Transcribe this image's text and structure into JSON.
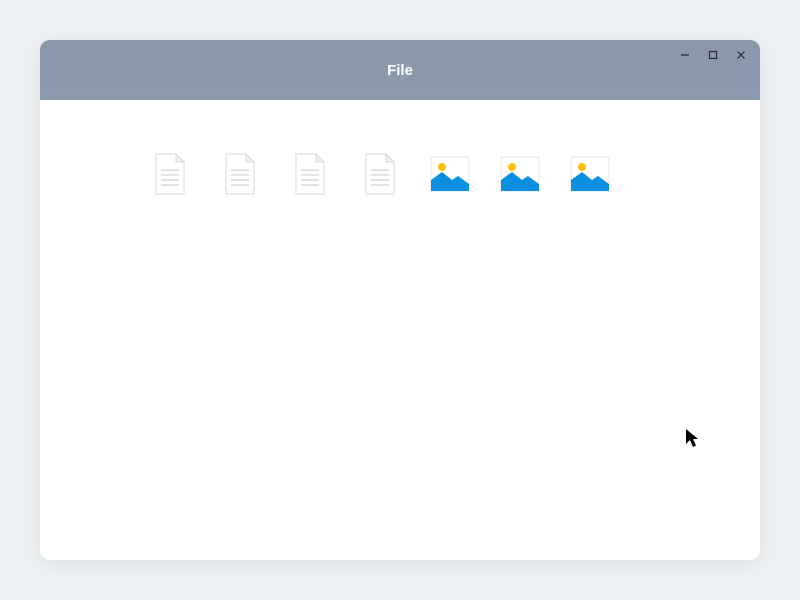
{
  "window": {
    "title": "File"
  },
  "files": [
    {
      "type": "document",
      "icon": "document-icon"
    },
    {
      "type": "document",
      "icon": "document-icon"
    },
    {
      "type": "document",
      "icon": "document-icon"
    },
    {
      "type": "document",
      "icon": "document-icon"
    },
    {
      "type": "image",
      "icon": "image-icon"
    },
    {
      "type": "image",
      "icon": "image-icon"
    },
    {
      "type": "image",
      "icon": "image-icon"
    }
  ]
}
